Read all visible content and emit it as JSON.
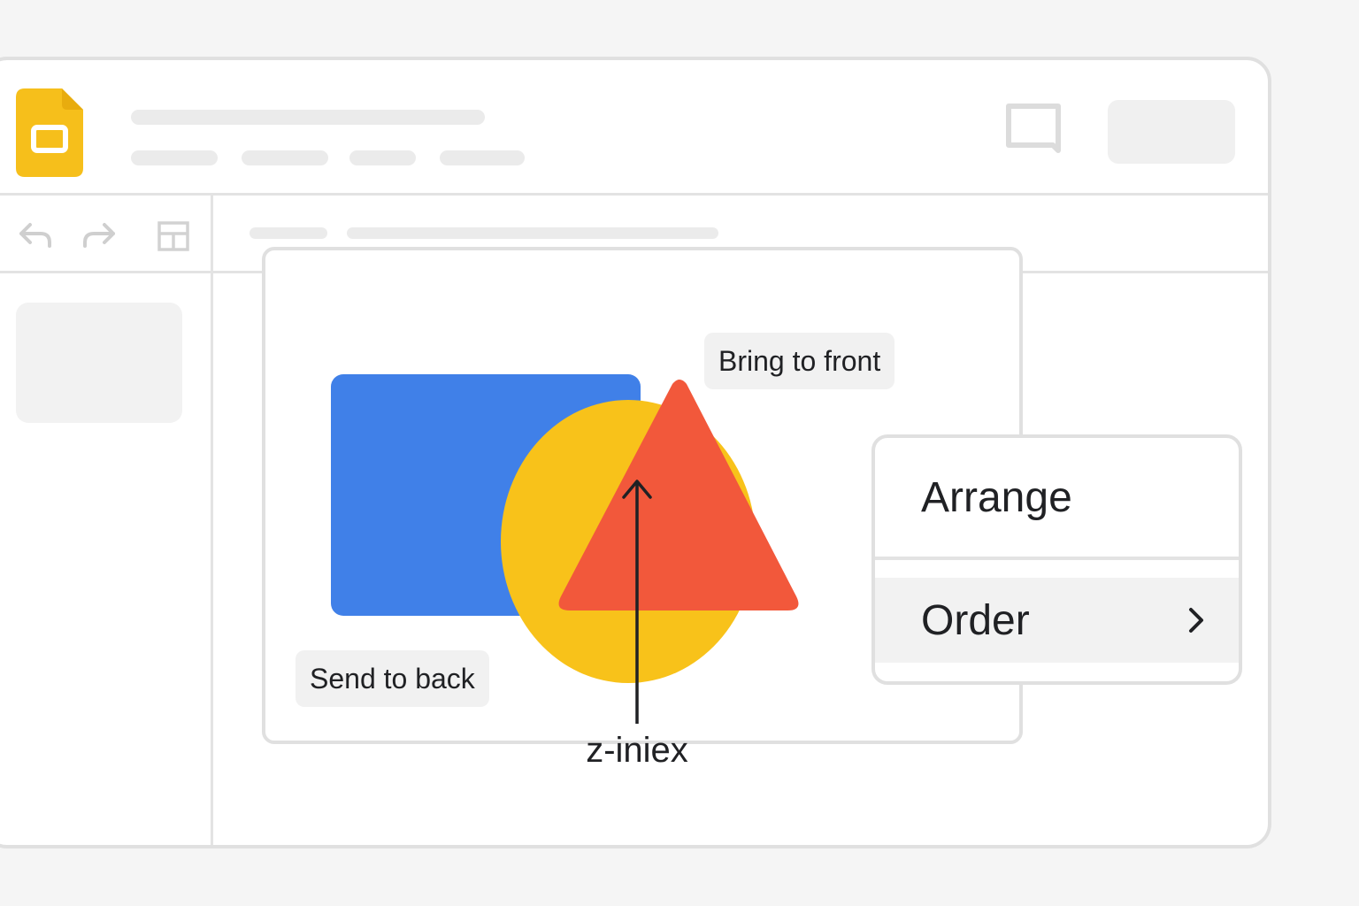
{
  "colors": {
    "brand_yellow": "#F6BF1B",
    "shape_blue": "#4080E8",
    "shape_yellow": "#F8C21A",
    "shape_red": "#F2583B",
    "text_dark": "#202124"
  },
  "icons": {
    "logo": "slides-logo-icon",
    "comment": "comment-icon",
    "undo": "undo-icon",
    "redo": "redo-icon",
    "layout": "layout-icon",
    "submenu": "chevron-right-icon"
  },
  "slide": {
    "labels": {
      "bring_to_front": "Bring to front",
      "send_to_back": "Send to back",
      "z_index": "z-iniex"
    }
  },
  "context_menu": {
    "arrange": "Arrange",
    "order": "Order"
  }
}
